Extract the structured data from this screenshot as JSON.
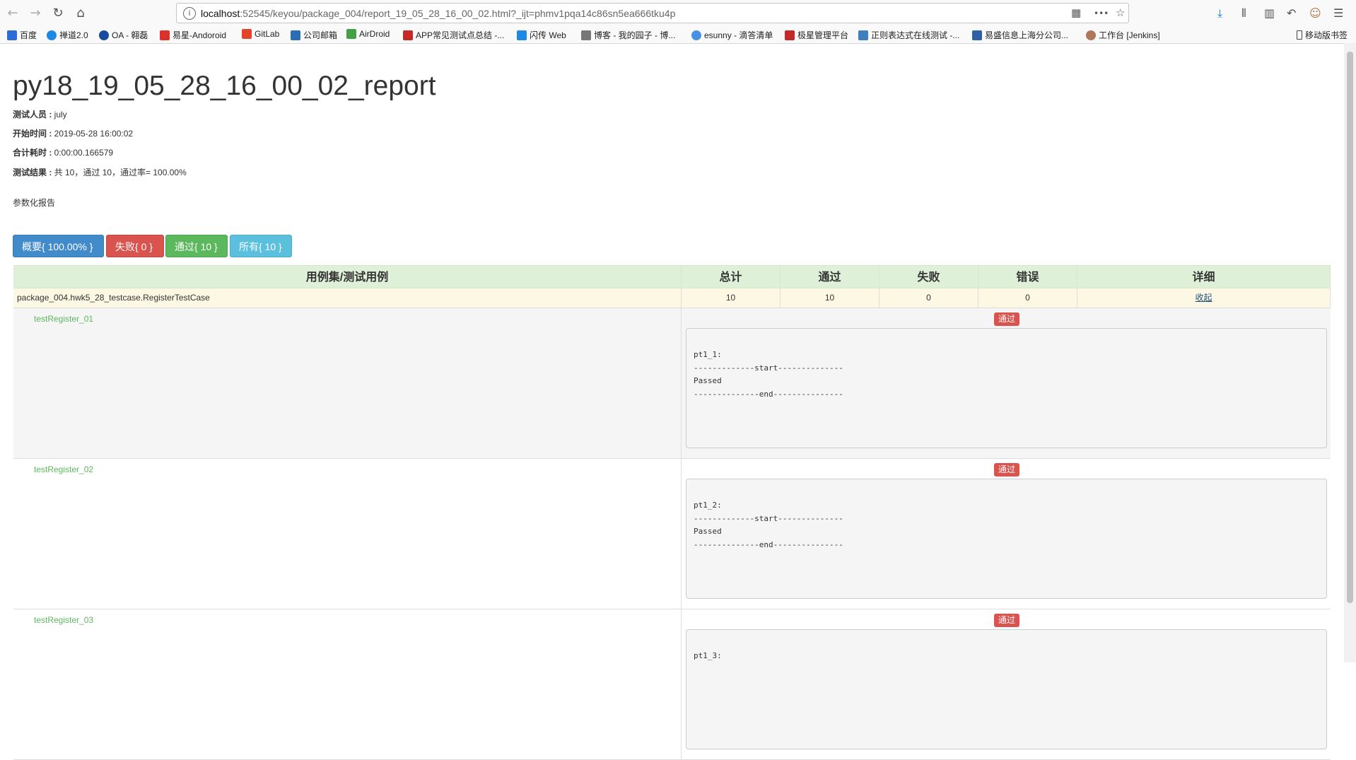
{
  "browser": {
    "url_host": "localhost",
    "url_rest": ":52545/keyou/package_004/report_19_05_28_16_00_02.html?_ijt=phmv1pqa14c86sn5ea666tku4p",
    "nav": {
      "back": "←",
      "forward": "→",
      "reload": "↻",
      "home": "⌂"
    },
    "url_icons": {
      "qr": "▦",
      "more": "•••",
      "star": "☆"
    },
    "toolbar_icons": {
      "download": "⤓",
      "library": "⫴",
      "sidebar": "▥",
      "undo": "↶",
      "avatar": "☺",
      "menu": "☰"
    },
    "bookmarks": [
      {
        "label": "百度",
        "color": "#2f6bd8"
      },
      {
        "label": "禅道2.0",
        "color": "#1e88e5"
      },
      {
        "label": "OA - 翱磊",
        "color": "#1a4aa0"
      },
      {
        "label": "易星-Andoroid",
        "color": "#d9322b"
      },
      {
        "label": "GitLab",
        "color": "#e24329"
      },
      {
        "label": "公司邮箱",
        "color": "#2a6db5"
      },
      {
        "label": "AirDroid",
        "color": "#43a047"
      },
      {
        "label": "APP常见测试点总结 -...",
        "color": "#c62828"
      },
      {
        "label": "闪传 Web",
        "color": "#1e88e5"
      },
      {
        "label": "博客 - 我的园子 - 博...",
        "color": "#777777"
      },
      {
        "label": "esunny - 滴答清单",
        "color": "#4a90e2"
      },
      {
        "label": "极星管理平台",
        "color": "#c62828"
      },
      {
        "label": "正则表达式在线测试 -...",
        "color": "#3f7fbf"
      },
      {
        "label": "易盛信息上海分公司...",
        "color": "#2e5fa8"
      },
      {
        "label": "工作台 [Jenkins]",
        "color": "#b0785a"
      }
    ],
    "mobile_bookmarks": "移动版书签"
  },
  "report": {
    "title": "py18_19_05_28_16_00_02_report",
    "tester_label": "测试人员 : ",
    "tester": "july",
    "start_label": "开始时间 : ",
    "start": "2019-05-28 16:00:02",
    "duration_label": "合计耗时 : ",
    "duration": "0:00:00.166579",
    "result_label": "测试结果 : ",
    "result": "共 10，通过 10，通过率= 100.00%",
    "description": "参数化报告",
    "buttons": {
      "summary": "概要{ 100.00% }",
      "failed": "失败{ 0 }",
      "passed": "通过{ 10 }",
      "all": "所有{ 10 }"
    },
    "colors": {
      "summary": "#428bca",
      "failed": "#d9534f",
      "passed": "#5cb85c",
      "all": "#5bc0de"
    }
  },
  "table": {
    "headers": [
      "用例集/测试用例",
      "总计",
      "通过",
      "失败",
      "错误",
      "详细"
    ],
    "suite": {
      "name": "package_004.hwk5_28_testcase.RegisterTestCase",
      "total": "10",
      "passed": "10",
      "failed": "0",
      "error": "0",
      "detail": "收起"
    },
    "cases": [
      {
        "name": "testRegister_01",
        "status": "通过",
        "log": "pt1_1:\n-------------start--------------\nPassed\n--------------end---------------"
      },
      {
        "name": "testRegister_02",
        "status": "通过",
        "log": "pt1_2:\n-------------start--------------\nPassed\n--------------end---------------"
      },
      {
        "name": "testRegister_03",
        "status": "通过",
        "log": "pt1_3:"
      }
    ]
  }
}
